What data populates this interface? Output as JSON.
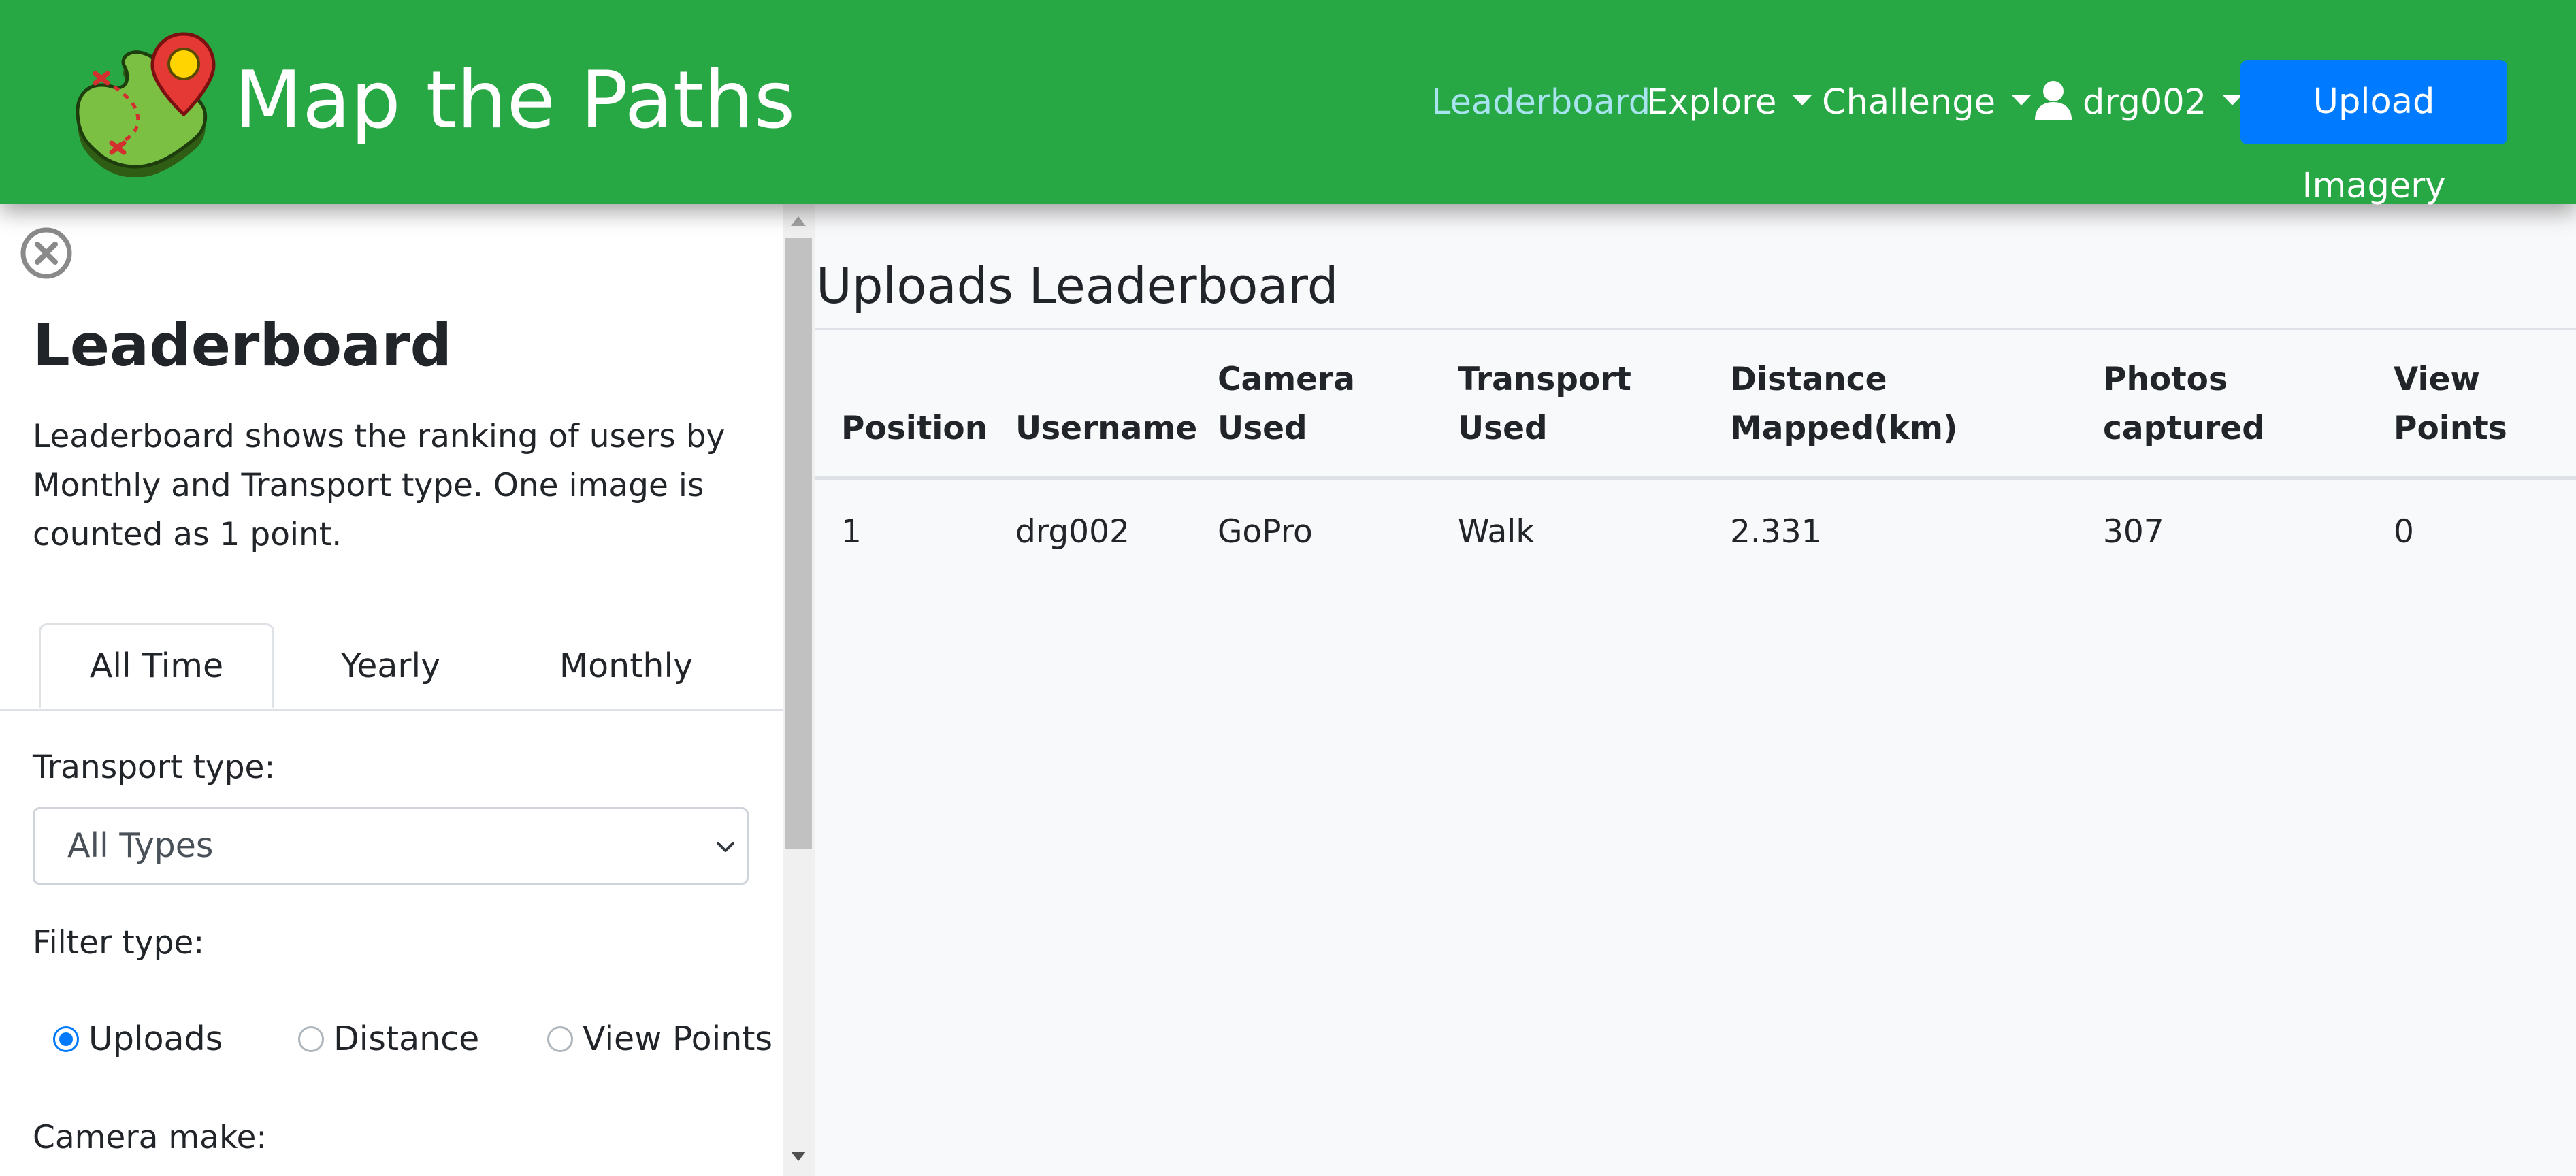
{
  "brand": {
    "title": "Map the Paths",
    "logo_icon": "map-pin-logo-icon"
  },
  "nav": {
    "leaderboard": "Leaderboard",
    "explore": "Explore",
    "challenge": "Challenge",
    "user": "drg002",
    "upload_button": "Upload Imagery"
  },
  "colors": {
    "navbar": "#28a745",
    "active_link": "#a8e3f0",
    "primary_button": "#007bff",
    "main_bg": "#f8f9fa"
  },
  "sidebar": {
    "title": "Leaderboard",
    "description": "Leaderboard shows the ranking of users by Monthly and Transport type. One image is counted as 1 point.",
    "tabs": [
      "All Time",
      "Yearly",
      "Monthly"
    ],
    "active_tab": "All Time",
    "transport_label": "Transport type:",
    "transport_value": "All Types",
    "filter_label": "Filter type:",
    "filter_options": [
      "Uploads",
      "Distance",
      "View Points"
    ],
    "filter_selected": "Uploads",
    "camera_label": "Camera make:"
  },
  "main": {
    "title": "Uploads Leaderboard",
    "columns": [
      [
        "Position"
      ],
      [
        "Username"
      ],
      [
        "Camera",
        "Used"
      ],
      [
        "Transport",
        "Used"
      ],
      [
        "Distance",
        "Mapped(km)"
      ],
      [
        "Photos",
        "captured"
      ],
      [
        "View",
        "Points"
      ]
    ],
    "rows": [
      [
        "1",
        "drg002",
        "GoPro",
        "Walk",
        "2.331",
        "307",
        "0"
      ]
    ]
  }
}
